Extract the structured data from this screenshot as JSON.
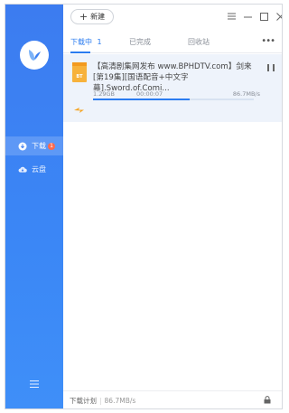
{
  "sidebar": {
    "logo_icon": "bird-logo-icon",
    "items": [
      {
        "label": "下载",
        "icon": "download-icon",
        "badge": "1",
        "active": true
      },
      {
        "label": "云盘",
        "icon": "cloud-icon",
        "active": false
      }
    ],
    "menu_icon": "hamburger-menu-icon"
  },
  "toolbar": {
    "new_label": "新建",
    "window_controls": [
      "menu-icon",
      "minimize-icon",
      "maximize-icon",
      "close-icon"
    ]
  },
  "tabs": [
    {
      "label": "下载中",
      "count": "1",
      "active": true
    },
    {
      "label": "已完成",
      "active": false
    },
    {
      "label": "回收站",
      "active": false
    }
  ],
  "more_label": "•••",
  "task": {
    "file_type": "BT",
    "title": "【高清剧集网发布 www.BPHDTV.com】剑来[第19集][国语配音+中文字幕].Sword.of.Comi...",
    "size": "1.29GB",
    "time": "00:00:07",
    "speed": "86.7MB/s",
    "progress": 0.6
  },
  "footer": {
    "plan_label": "下载计划",
    "speed": "86.7MB/s"
  },
  "colors": {
    "accent": "#2b7cf0",
    "sidebar": "#3c7cf0",
    "badge": "#ff6a4d",
    "file_icon": "#f7b23b"
  }
}
